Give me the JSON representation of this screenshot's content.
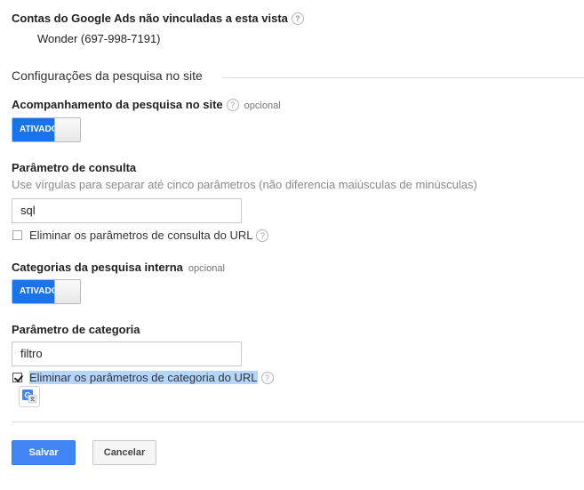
{
  "linked_accounts": {
    "title": "Contas do Google Ads não vinculadas a esta vista",
    "help_icon": "help-icon",
    "account": "Wonder (697-998-7191)"
  },
  "site_search": {
    "section_title": "Configurações da pesquisa no site",
    "tracking": {
      "label": "Acompanhamento da pesquisa no site",
      "optional": "opcional",
      "toggle_label": "ATIVADO",
      "toggle_on": true
    },
    "query_param": {
      "label": "Parâmetro de consulta",
      "hint": "Use vírgulas para separar até cinco parâmetros (não diferencia maiúsculas de minúsculas)",
      "value": "sql",
      "strip_label": "Eliminar os parâmetros de consulta do URL",
      "strip_checked": false
    },
    "categories": {
      "label": "Categorias da pesquisa interna",
      "optional": "opcional",
      "toggle_label": "ATIVADO",
      "toggle_on": true
    },
    "category_param": {
      "label": "Parâmetro de categoria",
      "value": "filtro",
      "strip_label": "Eliminar os parâmetros de categoria do URL",
      "strip_checked": true
    }
  },
  "actions": {
    "save_label": "Salvar",
    "cancel_label": "Cancelar"
  },
  "colors": {
    "toggle_on": "#1a73e8",
    "primary_button": "#4285f4",
    "selection_highlight": "#b4d5fe"
  }
}
